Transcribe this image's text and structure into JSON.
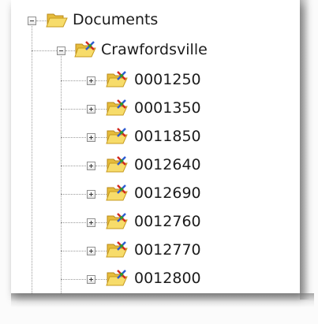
{
  "root": {
    "label": "Documents",
    "icon": "open-folder-icon",
    "expanded": true
  },
  "child": {
    "label": "Crawfordsville",
    "icon": "linked-folder-icon",
    "expanded": true
  },
  "items": [
    {
      "label": "0001250",
      "icon": "linked-folder-icon",
      "expanded": false
    },
    {
      "label": "0001350",
      "icon": "linked-folder-icon",
      "expanded": false
    },
    {
      "label": "0011850",
      "icon": "linked-folder-icon",
      "expanded": false
    },
    {
      "label": "0012640",
      "icon": "linked-folder-icon",
      "expanded": false
    },
    {
      "label": "0012690",
      "icon": "linked-folder-icon",
      "expanded": false
    },
    {
      "label": "0012760",
      "icon": "linked-folder-icon",
      "expanded": false
    },
    {
      "label": "0012770",
      "icon": "linked-folder-icon",
      "expanded": false
    },
    {
      "label": "0012800",
      "icon": "linked-folder-icon",
      "expanded": false
    }
  ],
  "colors": {
    "folder_yellow": "#f3d25a",
    "folder_edge": "#c79a1e",
    "x_red": "#d2281e",
    "x_blue": "#2c5bd2",
    "x_green": "#2e9a2e",
    "tree_line": "#9a9a9a"
  }
}
